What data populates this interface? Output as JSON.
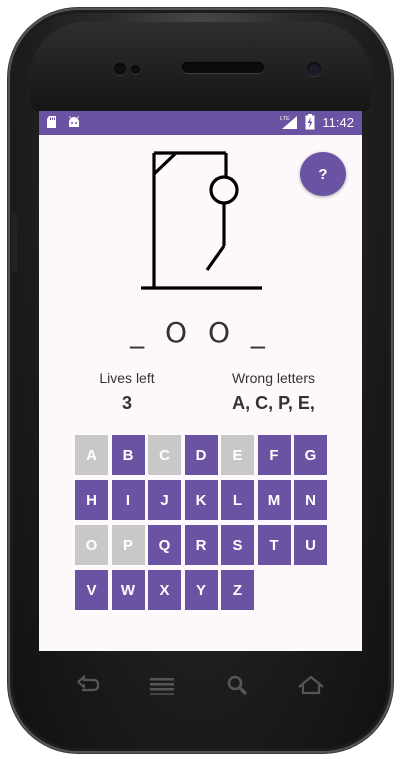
{
  "statusbar": {
    "time": "11:42",
    "network_label": "LTE",
    "icons": [
      "sd-card-icon",
      "android-icon",
      "lte-signal-icon",
      "battery-charging-icon"
    ],
    "color": "#6a53a3"
  },
  "help_button": {
    "label": "?"
  },
  "game": {
    "word": "_ O O _",
    "lives_label": "Lives left",
    "lives_value": "3",
    "wrong_label": "Wrong letters",
    "wrong_value": "A, C, P, E,"
  },
  "keyboard": {
    "rows": [
      [
        "A",
        "B",
        "C",
        "D",
        "E",
        "F",
        "G"
      ],
      [
        "H",
        "I",
        "J",
        "K",
        "L",
        "M",
        "N"
      ],
      [
        "O",
        "P",
        "Q",
        "R",
        "S",
        "T",
        "U"
      ],
      [
        "V",
        "W",
        "X",
        "Y",
        "Z"
      ]
    ],
    "used": [
      "A",
      "C",
      "E",
      "O",
      "P"
    ],
    "active_color": "#6a53a3",
    "used_color": "#c8c8c8"
  },
  "navbar": {
    "icons": [
      "back-icon",
      "menu-icon",
      "search-icon",
      "home-icon"
    ]
  }
}
